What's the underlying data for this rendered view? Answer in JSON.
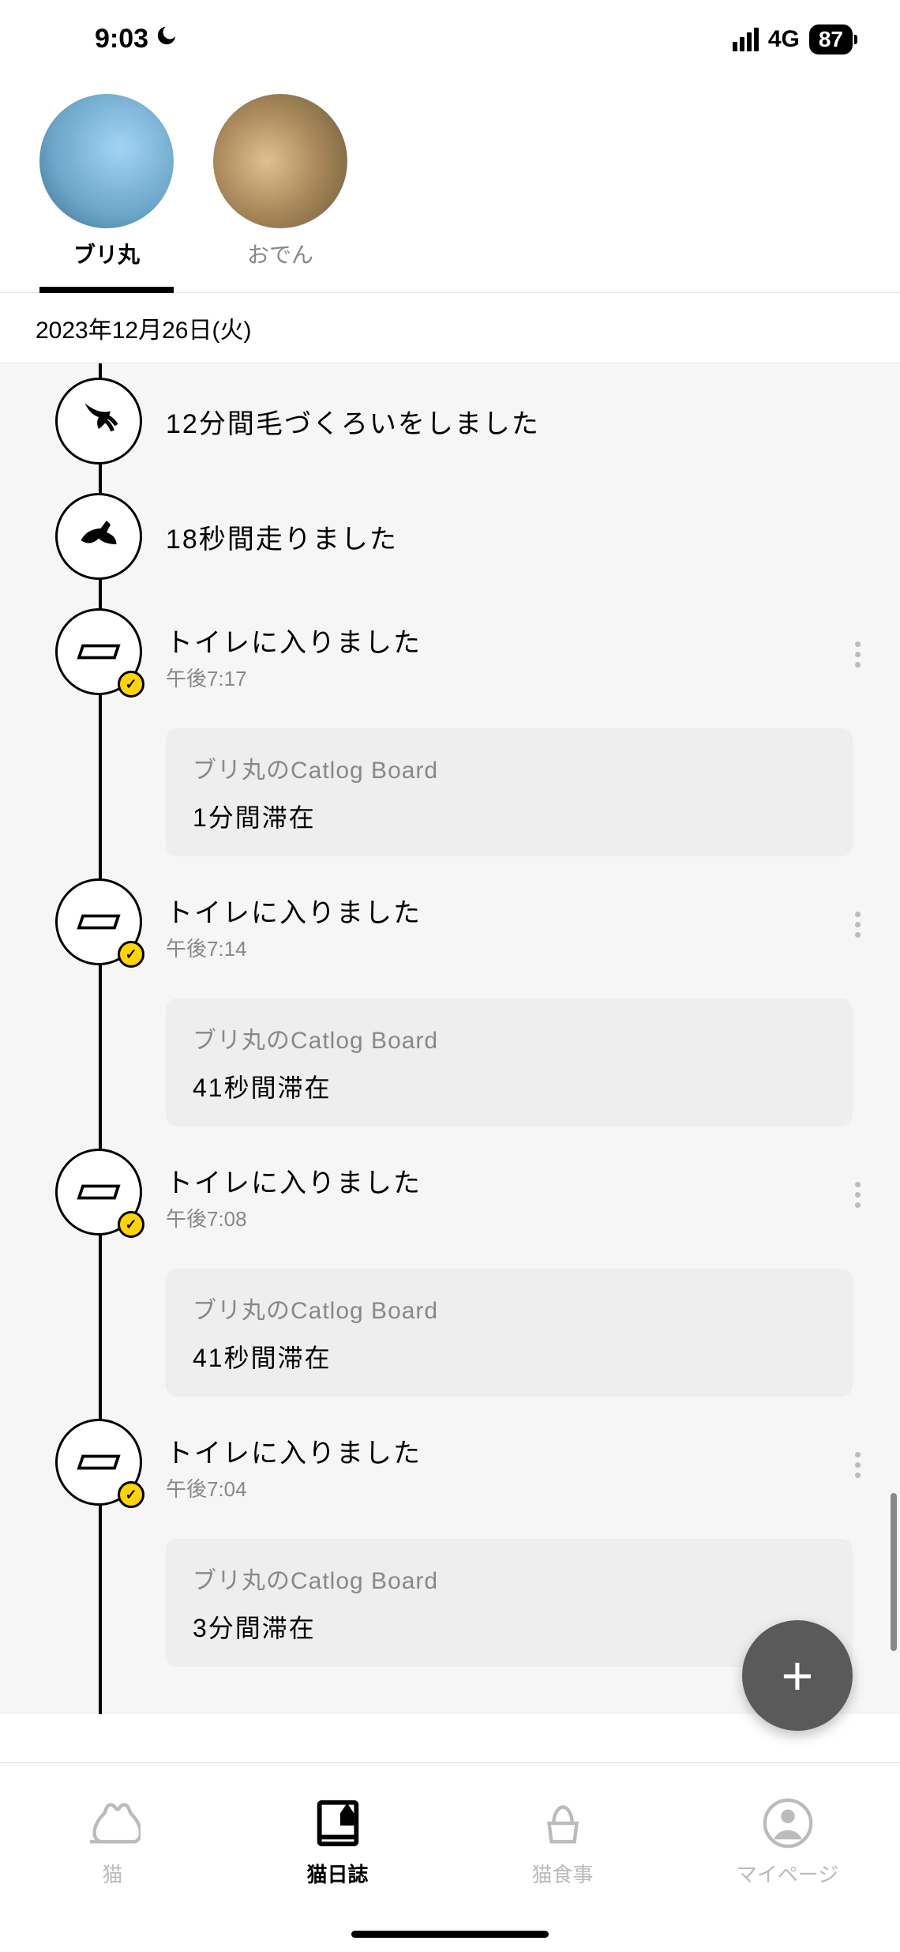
{
  "status": {
    "time": "9:03",
    "network": "4G",
    "battery": "87"
  },
  "pets": [
    {
      "name": "ブリ丸",
      "active": true
    },
    {
      "name": "おでん",
      "active": false
    }
  ],
  "date": "2023年12月26日(火)",
  "timeline": [
    {
      "type": "simple",
      "icon": "groom",
      "title": "12分間毛づくろいをしました"
    },
    {
      "type": "simple",
      "icon": "run",
      "title": "18秒間走りました"
    },
    {
      "type": "toilet",
      "title": "トイレに入りました",
      "time": "午後7:17",
      "detail_sub": "ブリ丸のCatlog Board",
      "detail_main": "1分間滞在"
    },
    {
      "type": "toilet",
      "title": "トイレに入りました",
      "time": "午後7:14",
      "detail_sub": "ブリ丸のCatlog Board",
      "detail_main": "41秒間滞在"
    },
    {
      "type": "toilet",
      "title": "トイレに入りました",
      "time": "午後7:08",
      "detail_sub": "ブリ丸のCatlog Board",
      "detail_main": "41秒間滞在"
    },
    {
      "type": "toilet",
      "title": "トイレに入りました",
      "time": "午後7:04",
      "detail_sub": "ブリ丸のCatlog Board",
      "detail_main": "3分間滞在"
    }
  ],
  "nav": [
    {
      "label": "猫",
      "active": false
    },
    {
      "label": "猫日誌",
      "active": true
    },
    {
      "label": "猫食事",
      "active": false
    },
    {
      "label": "マイページ",
      "active": false
    }
  ],
  "fab": "+"
}
